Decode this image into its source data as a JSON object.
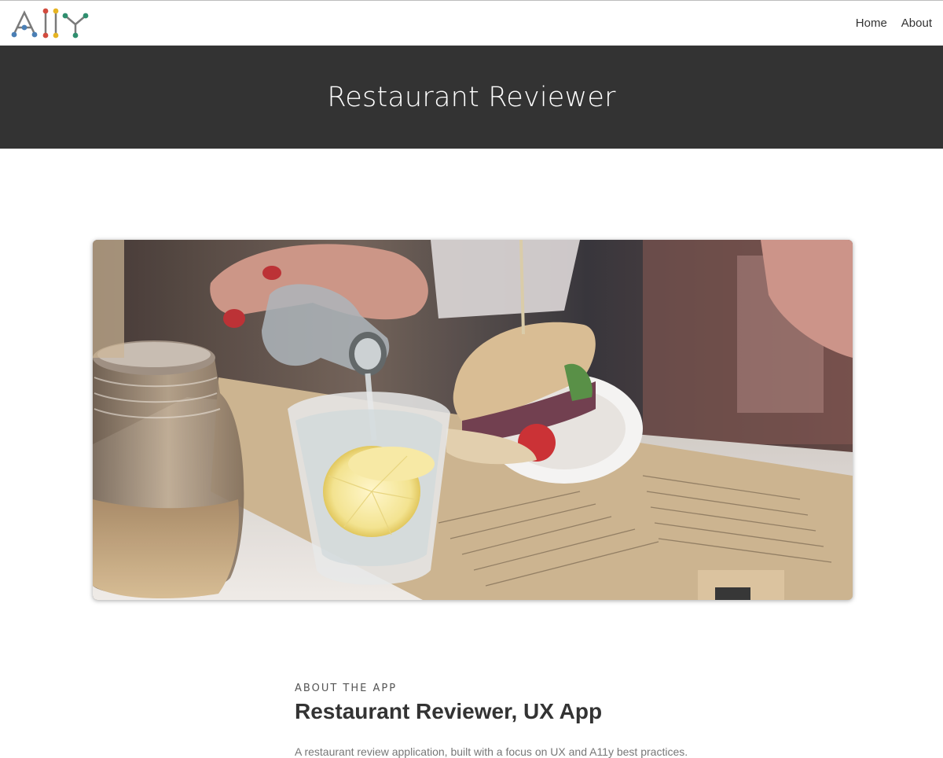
{
  "nav": {
    "logo_alt": "A11Y",
    "links": [
      "Home",
      "About"
    ]
  },
  "hero": {
    "title": "Restaurant Reviewer"
  },
  "about": {
    "eyebrow": "ABOUT THE APP",
    "title": "Restaurant Reviewer, UX App",
    "description": "A restaurant review application, built with a focus on UX and A11y best practices."
  },
  "colors": {
    "hero_bg": "#333333",
    "logo_blue": "#4a7fb5",
    "logo_red": "#d24b3e",
    "logo_yellow": "#e6b422",
    "logo_green": "#2f8f6f"
  },
  "icons": {
    "logo": "a11y-logo-icon"
  }
}
